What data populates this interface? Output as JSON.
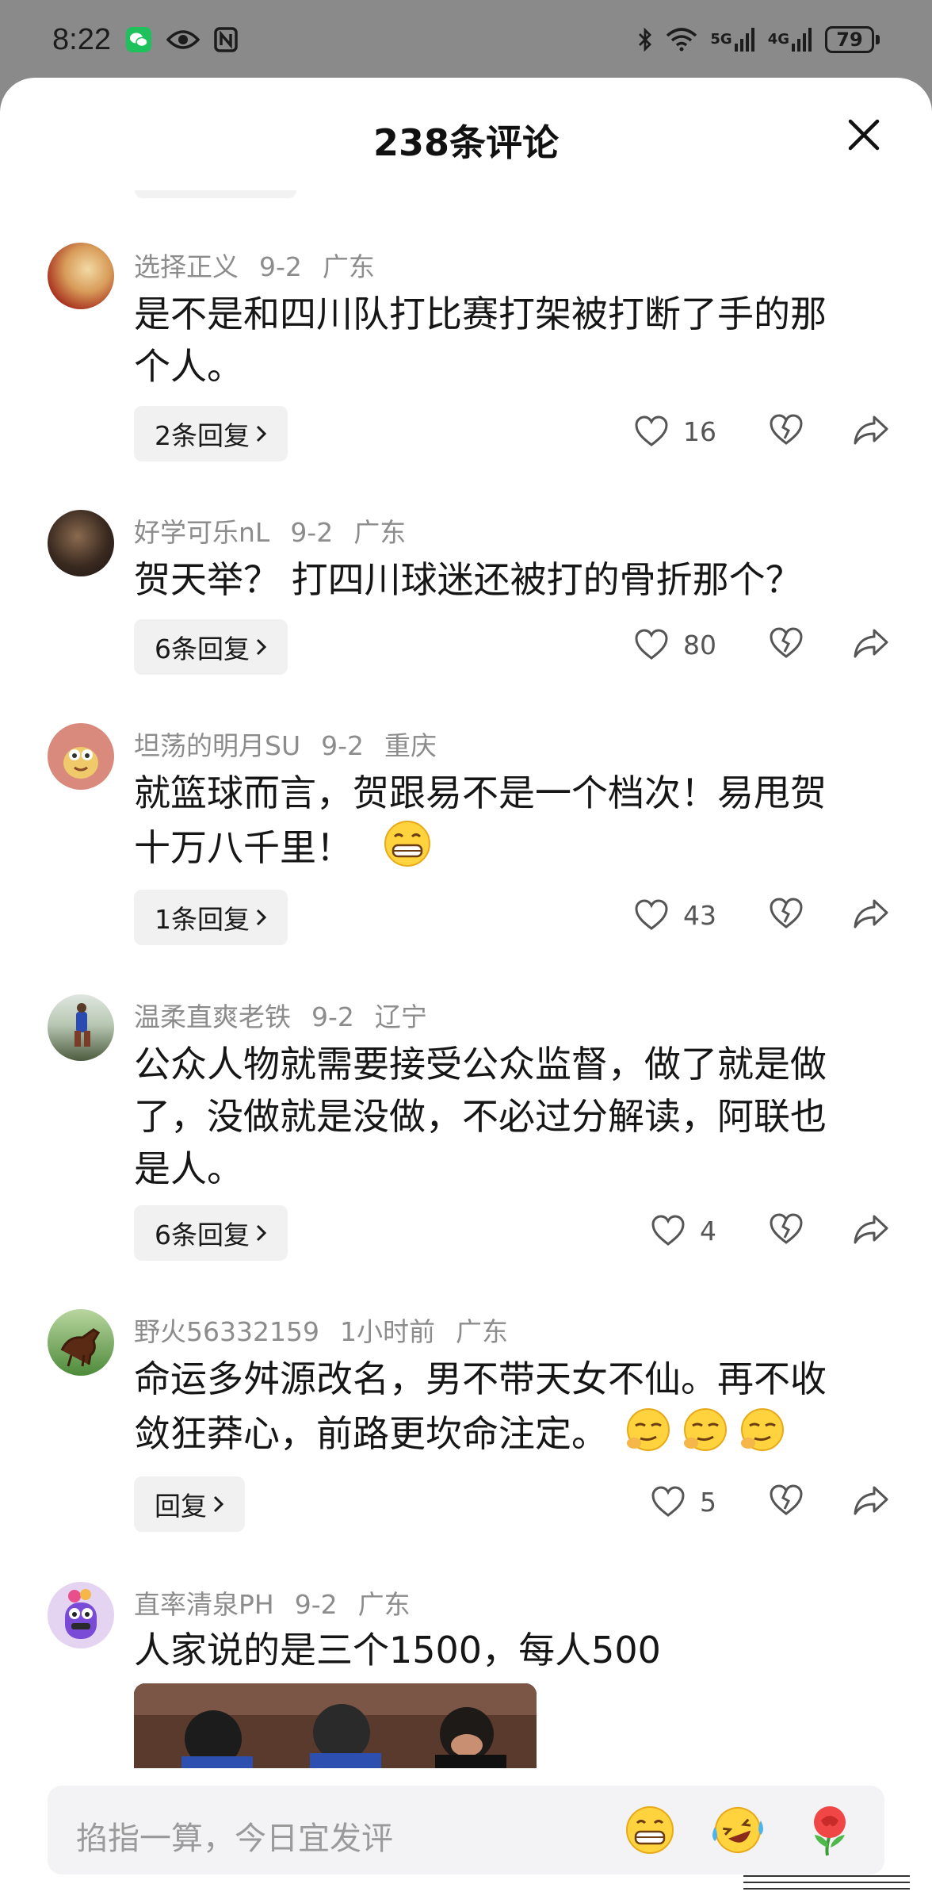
{
  "status_bar": {
    "time": "8:22",
    "network_1": "5G",
    "network_2": "4G",
    "battery": "79"
  },
  "sheet": {
    "title": "238条评论",
    "close_icon": "close-icon"
  },
  "comments": [
    {
      "username": "选择正义",
      "date": "9-2",
      "location": "广东",
      "text_line1": "是不是和四川队打比赛打架被打断了手的那",
      "text_line2": "个人。",
      "reply_label": "2条回复",
      "likes": "16"
    },
    {
      "username": "好学可乐nL",
      "date": "9-2",
      "location": "广东",
      "text_line1": "贺天举？ 打四川球迷还被打的骨折那个？",
      "reply_label": "6条回复",
      "likes": "80"
    },
    {
      "username": "坦荡的明月SU",
      "date": "9-2",
      "location": "重庆",
      "text_line1": "就篮球而言，贺跟易不是一个档次！易甩贺",
      "text_line2": "十万八千里！",
      "reply_label": "1条回复",
      "likes": "43"
    },
    {
      "username": "温柔直爽老铁",
      "date": "9-2",
      "location": "辽宁",
      "text_line1": "公众人物就需要接受公众监督，做了就是做",
      "text_line2": "了，没做就是没做，不必过分解读，阿联也",
      "text_line3": "是人。",
      "reply_label": "6条回复",
      "likes": "4"
    },
    {
      "username": "野火56332159",
      "date": "1小时前",
      "location": "广东",
      "text_line1": "命运多舛源改名，男不带天女不仙。再不收",
      "text_line2": "敛狂莽心，前路更坎命注定。",
      "reply_label": "回复",
      "likes": "5"
    },
    {
      "username": "直率清泉PH",
      "date": "9-2",
      "location": "广东",
      "text_line1": "人家说的是三个1500，每人500"
    }
  ],
  "input_bar": {
    "placeholder": "掐指一算，今日宜发评"
  },
  "colors": {
    "sheet_bg": "#ffffff",
    "status_bg": "#8a8a8a",
    "reply_bg": "#f1f1f2",
    "meta_text": "#8c8c8c"
  }
}
